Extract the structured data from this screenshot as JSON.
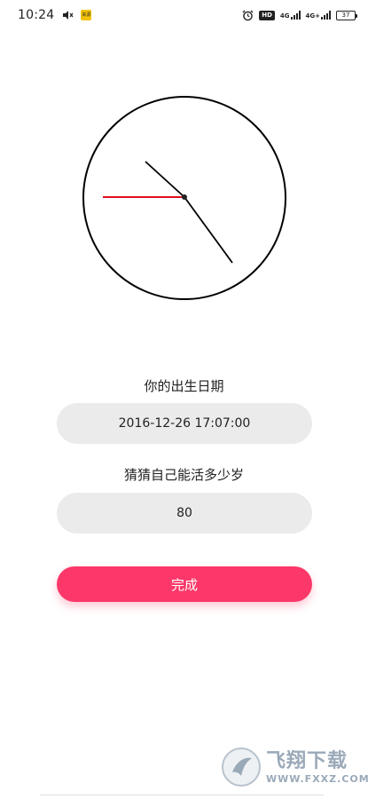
{
  "status_bar": {
    "time": "10:24",
    "notification_badge": "来源",
    "hd_label": "HD",
    "net1": "4G",
    "net2": "4G+",
    "battery": "37",
    "icons": [
      "mute-icon",
      "alarm-icon",
      "signal-icon",
      "battery-icon"
    ]
  },
  "clock": {
    "hour_hand_color": "#000000",
    "minute_hand_color": "#000000",
    "second_hand_color": "#e01020"
  },
  "form": {
    "birth_label": "你的出生日期",
    "birth_value": "2016-12-26 17:07:00",
    "guess_label": "猜猜自己能活多少岁",
    "guess_value": "80",
    "submit_label": "完成"
  },
  "colors": {
    "accent": "#fb3869",
    "field_bg": "#ebebeb"
  },
  "watermark": {
    "text": "飞翔下载",
    "url": "WWW.FXXZ.COM"
  }
}
